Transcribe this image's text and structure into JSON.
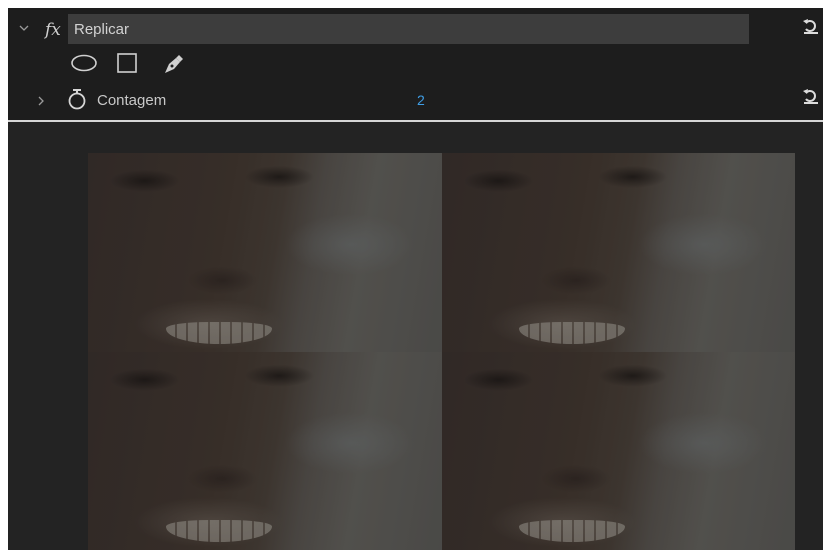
{
  "effect": {
    "name": "Replicar",
    "fx_label": "fx",
    "shape_tools": [
      "ellipse-mask-tool",
      "rectangle-mask-tool",
      "pen-mask-tool"
    ]
  },
  "parameter": {
    "label": "Contagem",
    "value": "2"
  },
  "preview": {
    "grid_rows": 2,
    "grid_cols": 2
  },
  "colors": {
    "panel": "#232323",
    "header": "#1d1d1d",
    "value_accent": "#3f9ee6"
  }
}
